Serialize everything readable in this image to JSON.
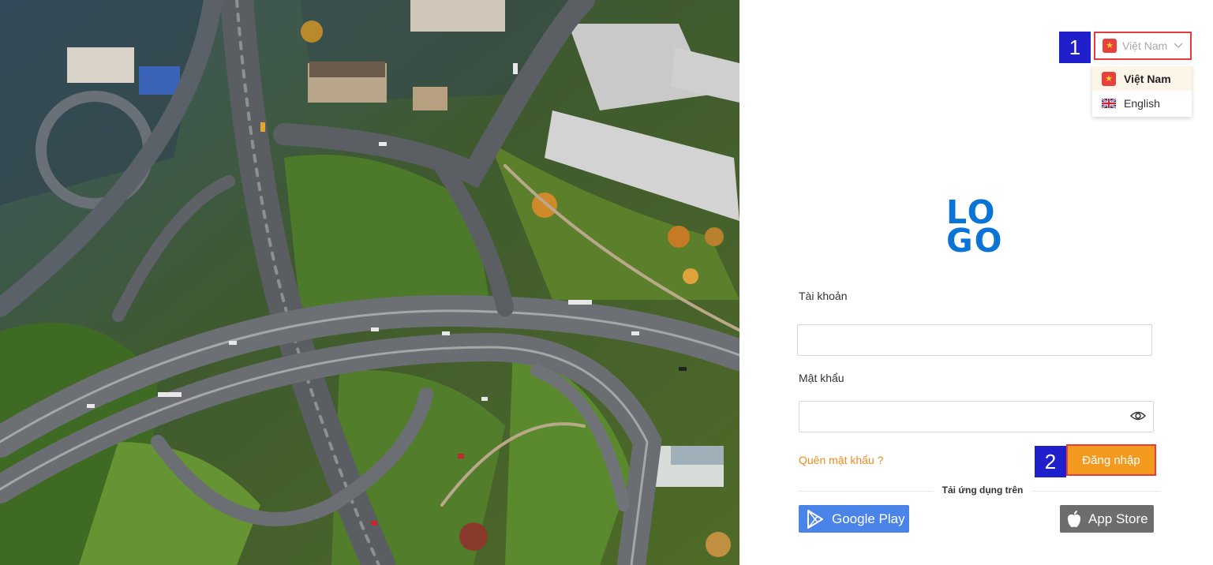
{
  "annotations": {
    "step1": "1",
    "step2": "2"
  },
  "language": {
    "selected": "Việt Nam",
    "options": [
      {
        "label": "Việt Nam",
        "flag": "vietnam-flag-icon",
        "active": true
      },
      {
        "label": "English",
        "flag": "uk-flag-icon",
        "active": false
      }
    ]
  },
  "logo": {
    "line1": "LO",
    "line2": "GO",
    "color": "#0a74d6"
  },
  "form": {
    "username_label": "Tài khoản",
    "username_value": "",
    "password_label": "Mật khẩu",
    "password_value": "",
    "forgot_link": "Quên mật khẩu ?",
    "login_button": "Đăng nhập"
  },
  "apps": {
    "download_label": "Tải ứng dụng trên",
    "google_play": "Google Play",
    "app_store": "App Store"
  },
  "colors": {
    "accent_orange": "#f39a1e",
    "link_orange": "#f08a24",
    "annotation_blue": "#1f1fcc",
    "highlight_red": "#e43b3b",
    "google_blue": "#4b84e8",
    "apple_gray": "#6d6d6d"
  }
}
